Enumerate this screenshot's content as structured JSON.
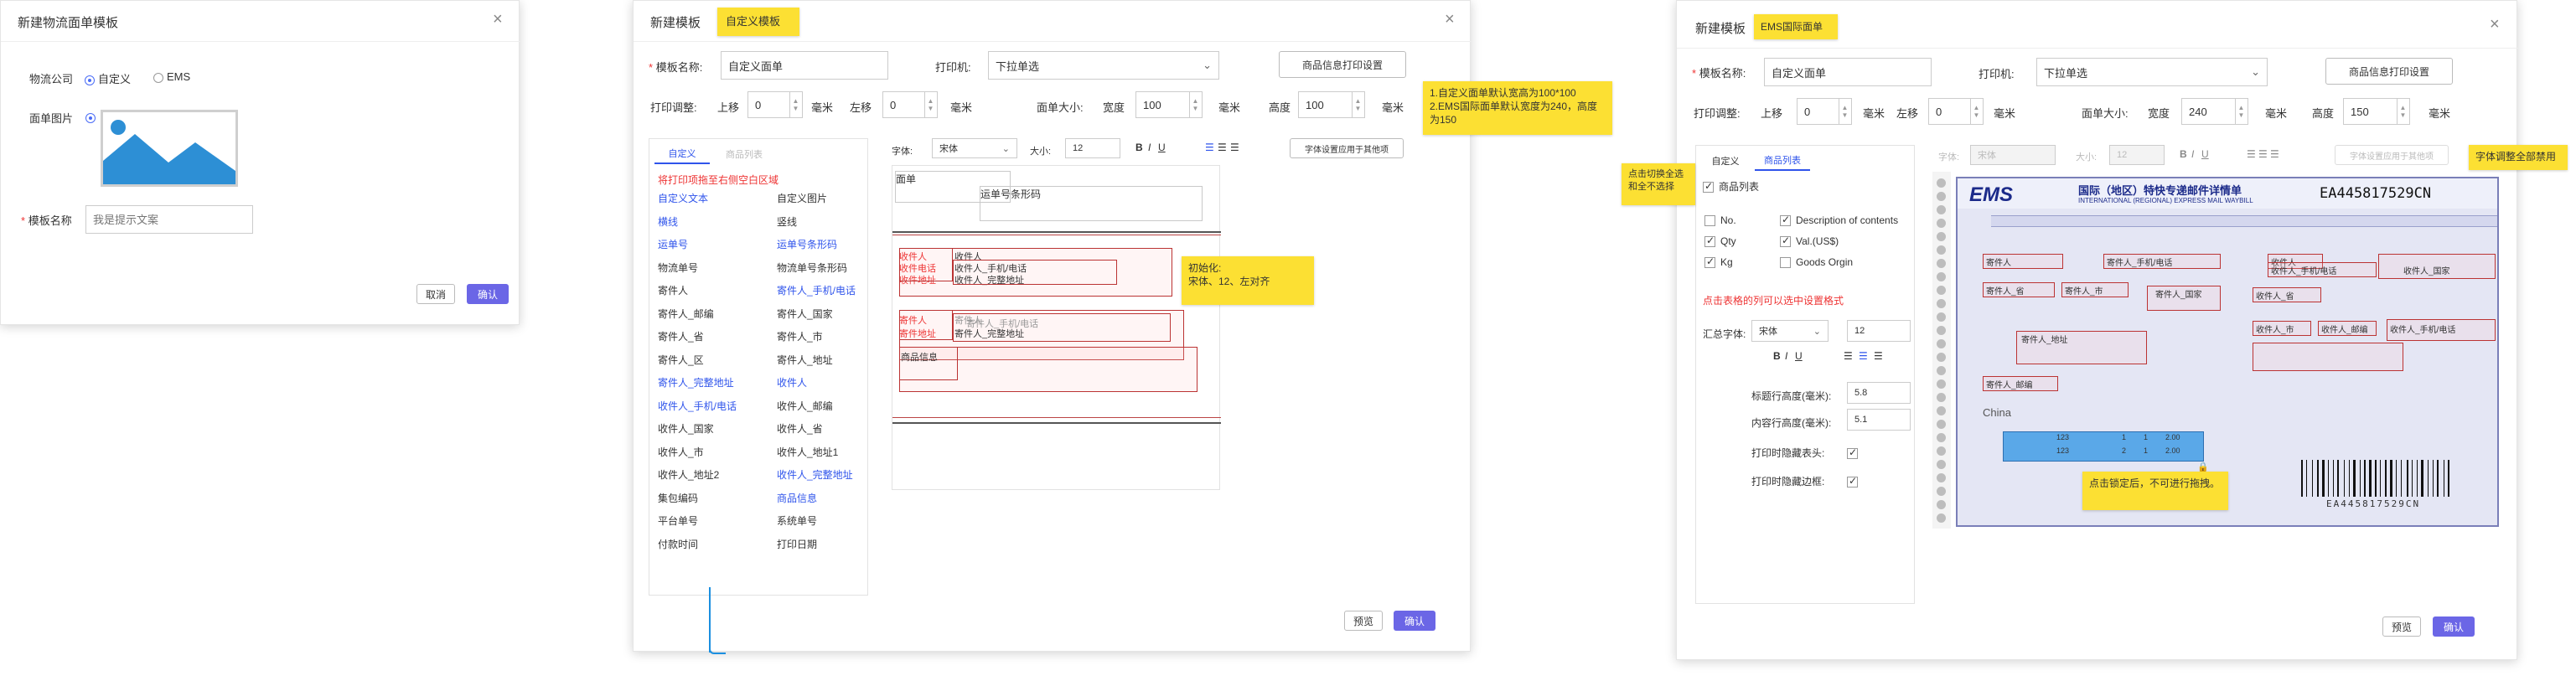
{
  "dialog1": {
    "title": "新建物流面单模板",
    "company_label": "物流公司",
    "opt_custom": "自定义",
    "opt_ems": "EMS",
    "image_label": "面单图片",
    "name_label": "模板名称",
    "name_placeholder": "我是提示文案",
    "cancel": "取消",
    "confirm": "确认"
  },
  "dialog2": {
    "title": "新建模板",
    "title_tag": "自定义模板",
    "name_label": "模板名称:",
    "name_value": "自定义面单",
    "printer_label": "打印机:",
    "printer_value": "下拉单选",
    "goods_btn": "商品信息打印设置",
    "adjust_label": "打印调整:",
    "top_label": "上移",
    "top_value": "0",
    "left_label": "左移",
    "left_value": "0",
    "mm": "毫米",
    "size_label": "面单大小:",
    "width_label": "宽度",
    "width_value": "100",
    "height_label": "高度",
    "height_value": "100",
    "tab_custom": "自定义",
    "tab_goods": "商品列表",
    "hint": "将打印项拖至右侧空白区域",
    "fields": [
      {
        "l": "自定义文本",
        "lc": "blue",
        "r": "自定义图片",
        "rc": "dark"
      },
      {
        "l": "横线",
        "lc": "blue",
        "r": "竖线",
        "rc": "dark"
      },
      {
        "l": "运单号",
        "lc": "blue",
        "r": "运单号条形码",
        "rc": "blue"
      },
      {
        "l": "物流单号",
        "lc": "dark",
        "r": "物流单号条形码",
        "rc": "dark"
      },
      {
        "l": "寄件人",
        "lc": "dark",
        "r": "寄件人_手机/电话",
        "rc": "blue"
      },
      {
        "l": "寄件人_邮编",
        "lc": "dark",
        "r": "寄件人_国家",
        "rc": "dark"
      },
      {
        "l": "寄件人_省",
        "lc": "dark",
        "r": "寄件人_市",
        "rc": "dark"
      },
      {
        "l": "寄件人_区",
        "lc": "dark",
        "r": "寄件人_地址",
        "rc": "dark"
      },
      {
        "l": "寄件人_完整地址",
        "lc": "blue",
        "r": "收件人",
        "rc": "blue"
      },
      {
        "l": "收件人_手机/电话",
        "lc": "blue",
        "r": "收件人_邮编",
        "rc": "dark"
      },
      {
        "l": "收件人_国家",
        "lc": "dark",
        "r": "收件人_省",
        "rc": "dark"
      },
      {
        "l": "收件人_市",
        "lc": "dark",
        "r": "收件人_地址1",
        "rc": "dark"
      },
      {
        "l": "收件人_地址2",
        "lc": "dark",
        "r": "收件人_完整地址",
        "rc": "blue"
      },
      {
        "l": "集包编码",
        "lc": "dark",
        "r": "商品信息",
        "rc": "blue"
      },
      {
        "l": "平台单号",
        "lc": "dark",
        "r": "系统单号",
        "rc": "dark"
      },
      {
        "l": "付款时间",
        "lc": "dark",
        "r": "打印日期",
        "rc": "dark"
      }
    ],
    "font_label": "字体:",
    "font_value": "宋体",
    "size_lbl": "大小:",
    "size_val": "12",
    "apply_btn": "字体设置应用于其他项",
    "canvas": {
      "sheet": "面单",
      "barcode": "运单号条形码",
      "recv": "收件人",
      "recv_phone": "收件电话",
      "recv_addr": "收件地址",
      "recv_v": "收件人",
      "recv_phone_v": "收件人_手机/电话",
      "recv_addr_v": "收件人_完整地址",
      "send": "寄件人",
      "send_addr": "寄件地址",
      "send_v": "寄件人",
      "send_phone_v": "寄件人_手机/电话",
      "send_addr_v": "寄件人_完整地址",
      "goods": "商品信息"
    },
    "note_defaults": "1.自定义面单默认宽高为100*100\n2.EMS国际面单默认宽度为240，高度为150",
    "note_init": "初始化:\n宋体、12、左对齐",
    "preview": "预览",
    "confirm": "确认"
  },
  "dialog3": {
    "title": "新建模板",
    "title_tag": "EMS国际面单",
    "name_label": "模板名称:",
    "name_value": "自定义面单",
    "printer_label": "打印机:",
    "printer_value": "下拉单选",
    "goods_btn": "商品信息打印设置",
    "adjust_label": "打印调整:",
    "top_label": "上移",
    "top_value": "0",
    "left_label": "左移",
    "left_value": "0",
    "mm": "毫米",
    "size_label": "面单大小:",
    "width_label": "宽度",
    "width_value": "240",
    "height_label": "高度",
    "height_value": "150",
    "tab_custom": "自定义",
    "tab_goods": "商品列表",
    "goods_list": "商品列表",
    "checks": [
      {
        "label": "No.",
        "on": false
      },
      {
        "label": "Description of contents",
        "on": true
      },
      {
        "label": "Qty",
        "on": true
      },
      {
        "label": "Val.(US$)",
        "on": true
      },
      {
        "label": "Kg",
        "on": true
      },
      {
        "label": "Goods Orgin",
        "on": false
      }
    ],
    "col_hint": "点击表格的列可以选中设置格式",
    "sum_font_label": "汇总字体:",
    "sum_font_value": "宋体",
    "sum_size_value": "12",
    "title_height_label": "标题行高度(毫米):",
    "title_height_value": "5.8",
    "content_height_label": "内容行高度(毫米):",
    "content_height_value": "5.1",
    "hide_header": "打印时隐藏表头:",
    "hide_border": "打印时隐藏边框:",
    "font_label": "字体:",
    "font_value": "宋体",
    "size_lbl": "大小:",
    "size_val": "12",
    "apply_btn": "字体设置应用于其他项",
    "note_switch": "点击切换全选和全不选择",
    "note_font": "字体调整全部禁用",
    "note_lock": "点击锁定后，不可进行拖拽。",
    "ems_logo": "EMS",
    "ems_header": "国际（地区）特快专递邮件详情单",
    "ems_sub": "INTERNATIONAL (REGIONAL) EXPRESS MAIL WAYBILL",
    "tracking": "EA445817529CN",
    "barcode_text": "EA445817529CN",
    "cells": {
      "send": "寄件人",
      "send_phone": "寄件人_手机/电话",
      "send_prov": "寄件人_省",
      "send_city": "寄件人_市",
      "send_country": "寄件人_国家",
      "send_addr": "寄件人_地址",
      "send_zip": "寄件人_邮编",
      "recv": "收件人",
      "recv_phone": "收件人_手机/电话",
      "recv_prov": "收件人_省",
      "recv_city": "收件人_市",
      "recv_country": "收件人_国家",
      "recv_zip": "收件人_邮编",
      "recv_addr": "收件人_地址",
      "china": "China",
      "row1_a": "123",
      "row1_b": "1",
      "row1_c": "1",
      "row1_d": "2.00",
      "row2_a": "123",
      "row2_b": "2",
      "row2_c": "1",
      "row2_d": "2.00"
    },
    "preview": "预览",
    "confirm": "确认"
  },
  "colors": {
    "accent": "#6b66e6",
    "note": "#fce033",
    "warn": "#e33333",
    "link": "#2f54eb"
  }
}
